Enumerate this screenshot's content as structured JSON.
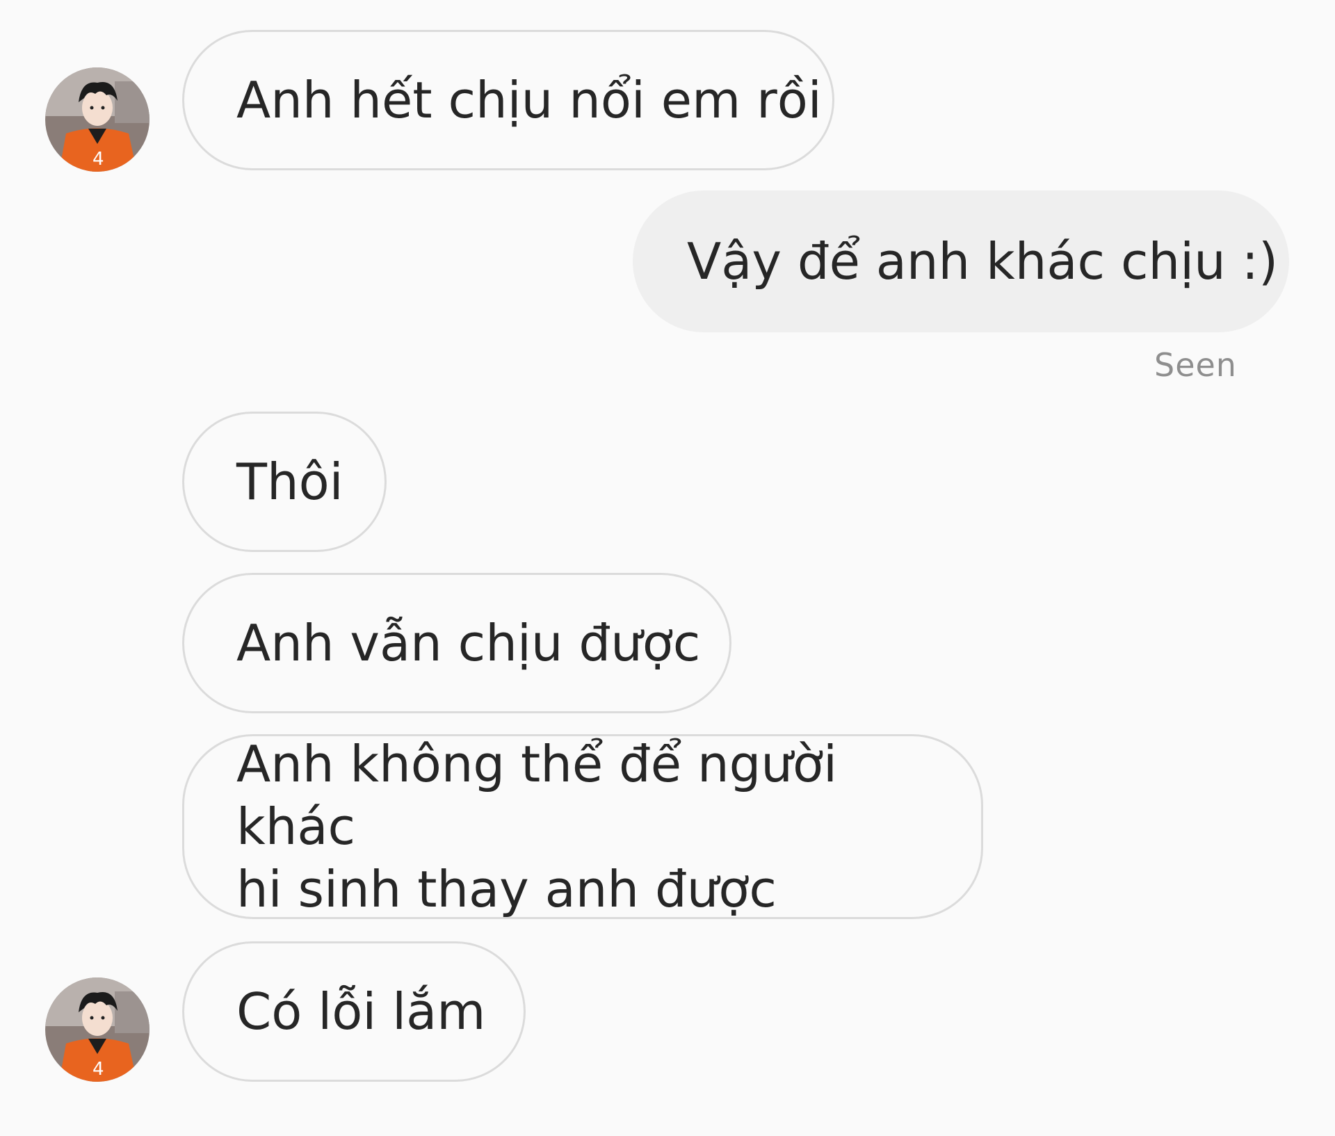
{
  "messages": [
    {
      "sender": "them",
      "text": "Anh hết chịu nổi em rồi"
    },
    {
      "sender": "me",
      "text": "Vậy để anh khác chịu :)"
    },
    {
      "sender": "them",
      "text": "Thôi"
    },
    {
      "sender": "them",
      "text": "Anh vẫn chịu được"
    },
    {
      "sender": "them",
      "lines": [
        "Anh không thể để người khác",
        "hi sinh thay anh được"
      ]
    },
    {
      "sender": "them",
      "text": "Có lỗi lắm"
    }
  ],
  "seen_label": "Seen",
  "colors": {
    "background": "#fafafa",
    "incoming_border": "#dbdbdb",
    "outgoing_fill": "#efefef",
    "text": "#262626",
    "seen_text": "#8e8e8e",
    "avatar_jersey": "#e8641f"
  },
  "avatar_icon": "user-avatar-icon"
}
